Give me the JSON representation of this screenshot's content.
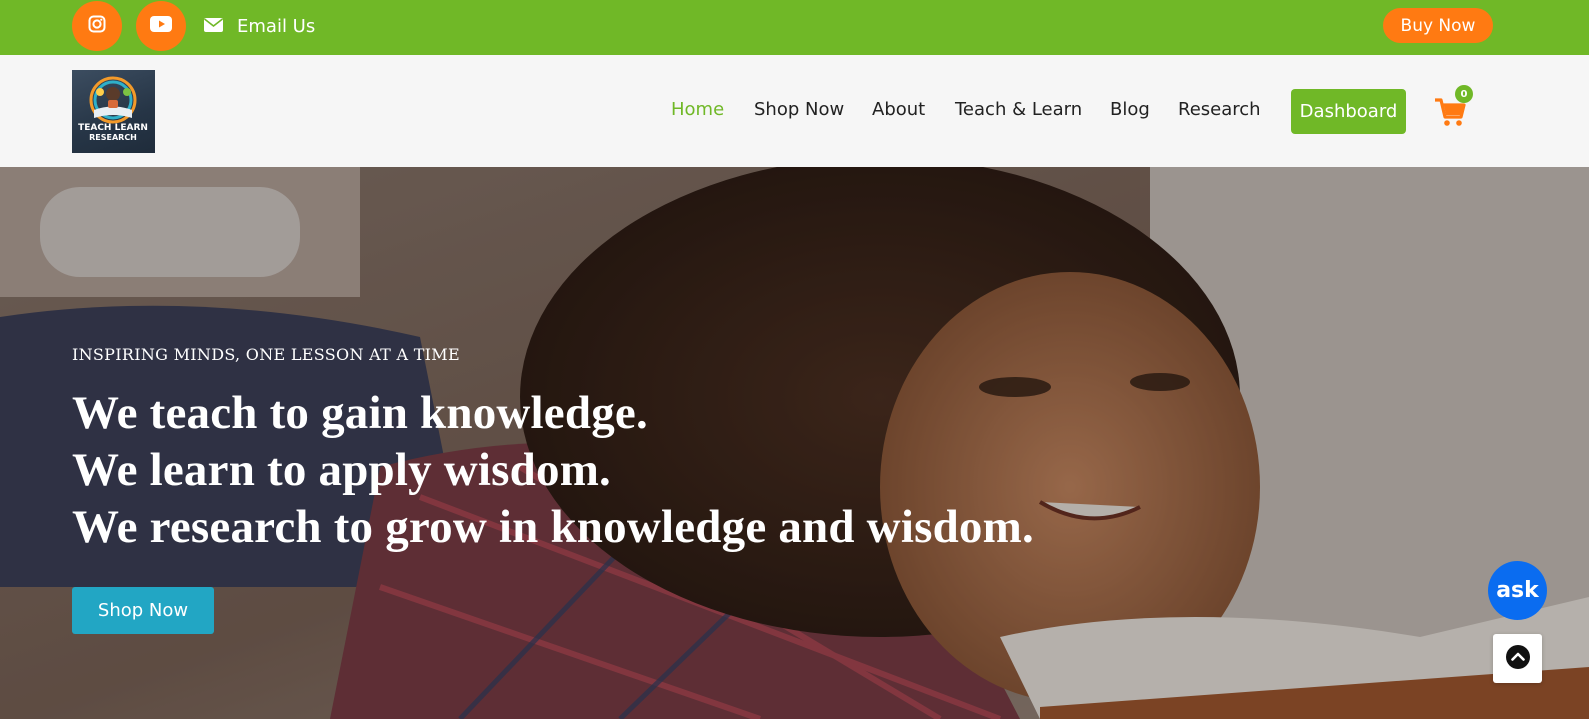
{
  "topbar": {
    "social": [
      {
        "icon": "instagram-icon"
      },
      {
        "icon": "youtube-icon"
      }
    ],
    "email_label": "Email Us",
    "buy_now_label": "Buy Now"
  },
  "header": {
    "logo_text": [
      "TEACH LEARN",
      "RESEARCH"
    ],
    "nav": [
      {
        "label": "Home",
        "active": true
      },
      {
        "label": "Shop Now"
      },
      {
        "label": "About"
      },
      {
        "label": "Teach & Learn"
      },
      {
        "label": "Blog"
      },
      {
        "label": "Research"
      }
    ],
    "dashboard_label": "Dashboard",
    "cart_count": "0"
  },
  "hero": {
    "kicker": "INSPIRING MINDS, ONE LESSON AT A TIME",
    "lines": [
      "We teach to gain knowledge.",
      "We learn to apply wisdom.",
      "We research to grow in knowledge and wisdom."
    ],
    "cta_label": "Shop Now"
  },
  "widgets": {
    "ask_label": "ask",
    "scroll_top_icon": "chevron-up-icon"
  },
  "colors": {
    "green": "#70b827",
    "orange": "#ff7a12",
    "teal": "#22a6c4",
    "blue": "#0a6cf0"
  }
}
